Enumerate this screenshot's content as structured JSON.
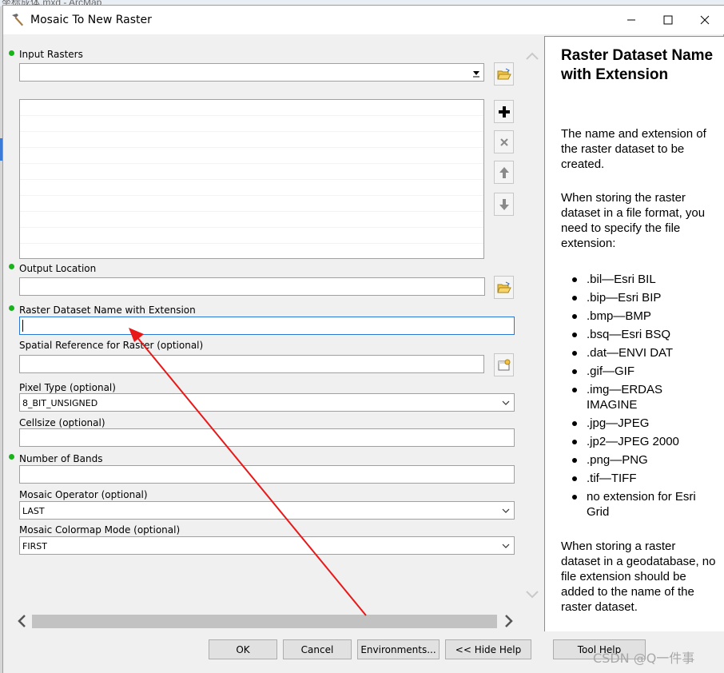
{
  "background": {
    "app_title": "坐标成体.mxd - ArcMap"
  },
  "window": {
    "title": "Mosaic To New Raster"
  },
  "labels": {
    "input_rasters": "Input Rasters",
    "output_location": "Output Location",
    "dataset_name": "Raster Dataset Name with Extension",
    "spatial_ref": "Spatial Reference for Raster (optional)",
    "pixel_type": "Pixel Type (optional)",
    "cellsize": "Cellsize (optional)",
    "num_bands": "Number of Bands",
    "mosaic_operator": "Mosaic Operator (optional)",
    "colormap_mode": "Mosaic Colormap Mode (optional)"
  },
  "values": {
    "pixel_type": "8_BIT_UNSIGNED",
    "mosaic_operator": "LAST",
    "colormap_mode": "FIRST"
  },
  "help": {
    "title": "Raster Dataset Name with Extension",
    "para1": "The name and extension of the raster dataset to be created.",
    "para2": "When storing the raster dataset in a file format, you need to specify the file extension:",
    "extensions": [
      ".bil—Esri BIL",
      ".bip—Esri BIP",
      ".bmp—BMP",
      ".bsq—Esri BSQ",
      ".dat—ENVI DAT",
      ".gif—GIF",
      ".img—ERDAS IMAGINE",
      ".jpg—JPEG",
      ".jp2—JPEG 2000",
      ".png—PNG",
      ".tif—TIFF",
      "no extension for Esri Grid"
    ],
    "para3": "When storing a raster dataset in a geodatabase, no file extension should be added to the name of the raster dataset."
  },
  "buttons": {
    "ok": "OK",
    "cancel": "Cancel",
    "environments": "Environments...",
    "hide_help": "<< Hide Help",
    "tool_help": "Tool Help"
  },
  "watermark": "CSDN @Q一件事",
  "colors": {
    "required_dot": "#19b31c",
    "annotation_arrow": "#e81818",
    "focus_border": "#2a78d4"
  }
}
